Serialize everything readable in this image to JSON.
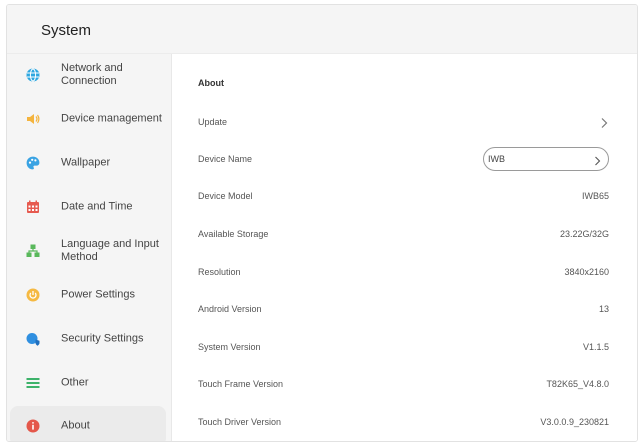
{
  "app": {
    "title": "System"
  },
  "sidebar": {
    "items": [
      {
        "label": "Network and Connection",
        "icon": "globe-icon",
        "color": "#2ea7e0"
      },
      {
        "label": "Device management",
        "icon": "speaker-icon",
        "color": "#f4b43e"
      },
      {
        "label": "Wallpaper",
        "icon": "palette-icon",
        "color": "#3aa3e3"
      },
      {
        "label": "Date and Time",
        "icon": "calendar-icon",
        "color": "#e65a4f"
      },
      {
        "label": "Language and Input Method",
        "icon": "language-icon",
        "color": "#59b85b"
      },
      {
        "label": "Power Settings",
        "icon": "power-icon",
        "color": "#f5b942"
      },
      {
        "label": "Security Settings",
        "icon": "shield-icon",
        "color": "#2f8fe0"
      },
      {
        "label": "Other",
        "icon": "menu-icon",
        "color": "#3db26a"
      },
      {
        "label": "About",
        "icon": "info-icon",
        "color": "#e4574a",
        "selected": true
      }
    ]
  },
  "main": {
    "section_title": "About",
    "update_label": "Update",
    "device_name_label": "Device Name",
    "device_name_value": "IWB",
    "rows": [
      {
        "label": "Device Model",
        "value": "IWB65"
      },
      {
        "label": "Available Storage",
        "value": "23.22G/32G"
      },
      {
        "label": "Resolution",
        "value": "3840x2160"
      },
      {
        "label": "Android Version",
        "value": "13"
      },
      {
        "label": "System Version",
        "value": "V1.1.5"
      },
      {
        "label": "Touch Frame Version",
        "value": "T82K65_V4.8.0"
      },
      {
        "label": "Touch Driver Version",
        "value": "V3.0.0.9_230821"
      }
    ]
  }
}
